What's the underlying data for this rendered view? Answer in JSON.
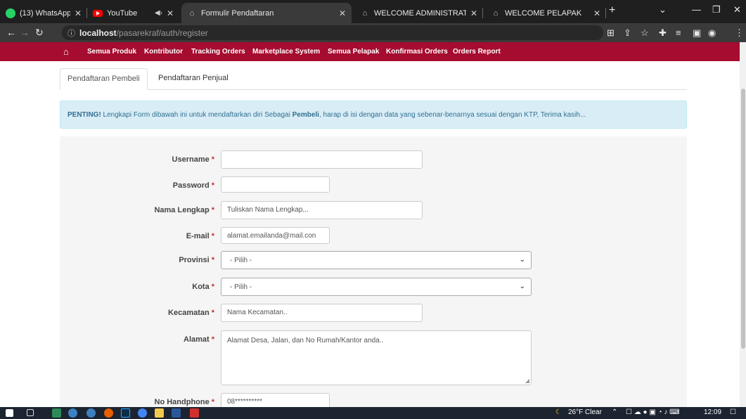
{
  "browser": {
    "tabs": [
      {
        "label": "(13) WhatsApp",
        "icon": "whatsapp-icon"
      },
      {
        "label": "YouTube",
        "icon": "youtube-icon"
      },
      {
        "label": "Formulir Pendaftaran",
        "icon": "page-icon",
        "active": true
      },
      {
        "label": "WELCOME ADMINISTRATOR",
        "icon": "page-icon"
      },
      {
        "label": "WELCOME PELAPAK",
        "icon": "page-icon"
      }
    ],
    "url_host": "localhost",
    "url_path": "/pasarekraf/auth/register"
  },
  "site_nav": {
    "items": [
      "Semua Produk",
      "Kontributor",
      "Tracking Orders",
      "Marketplace System",
      "Semua Pelapak",
      "Konfirmasi Orders",
      "Orders Report"
    ],
    "color": "#a60c2f"
  },
  "form_tabs": [
    "Pendaftaran Pembeli",
    "Pendaftaran Penjual"
  ],
  "alert": {
    "strong": "PENTING!",
    "text1": " Lengkapi Form dibawah ini untuk mendaftarkan diri Sebagai ",
    "bold2": "Pembeli",
    "text2": ", harap di isi dengan data yang sebenar-benarnya sesuai dengan KTP, Terima kasih..."
  },
  "form": {
    "required_mark": "*",
    "username": {
      "label": "Username",
      "value": ""
    },
    "password": {
      "label": "Password",
      "value": ""
    },
    "nama": {
      "label": "Nama Lengkap",
      "value": "Tuliskan Nama Lengkap,.."
    },
    "email": {
      "label": "E-mail",
      "value": "alamat.emailanda@mail.con"
    },
    "provinsi": {
      "label": "Provinsi",
      "selected": "- Pilih -"
    },
    "kota": {
      "label": "Kota",
      "selected": "- Pilih -"
    },
    "kecamatan": {
      "label": "Kecamatan",
      "value": "Nama Kecamatan.."
    },
    "alamat": {
      "label": "Alamat",
      "value": "Alamat Desa, Jalan, dan No Rumah/Kantor anda.."
    },
    "handphone": {
      "label": "No Handphone",
      "value": "08**********"
    }
  },
  "taskbar": {
    "weather": "26°F  Clear",
    "time": "12:09"
  }
}
